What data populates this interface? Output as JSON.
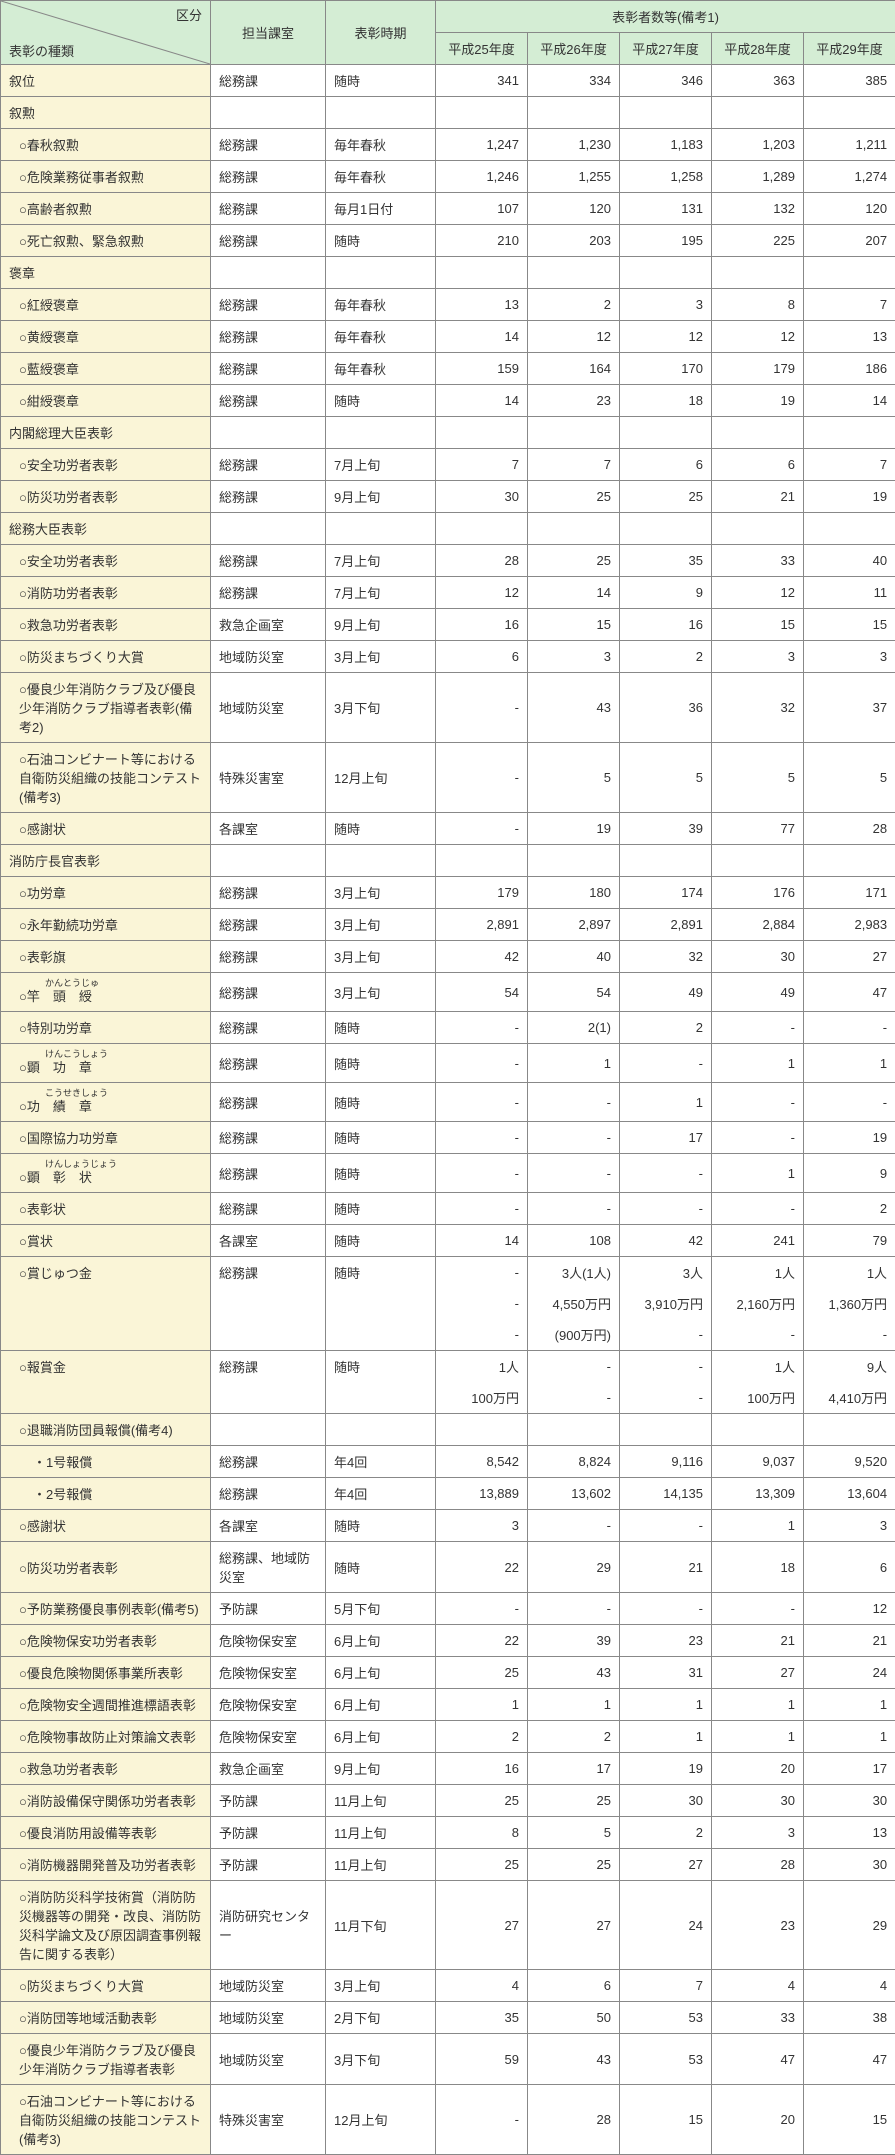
{
  "header": {
    "diag_top": "区分",
    "diag_bottom": "表彰の種類",
    "dept": "担当課室",
    "timing": "表彰時期",
    "count_group": "表彰者数等(備考1)",
    "years": [
      "平成25年度",
      "平成26年度",
      "平成27年度",
      "平成28年度",
      "平成29年度"
    ]
  },
  "rows": [
    {
      "t": "d",
      "label": "叙位",
      "dept": "総務課",
      "time": "随時",
      "v": [
        "341",
        "334",
        "346",
        "363",
        "385"
      ]
    },
    {
      "t": "c",
      "label": "叙勲"
    },
    {
      "t": "d",
      "label": "○春秋叙勲",
      "dept": "総務課",
      "time": "毎年春秋",
      "v": [
        "1,247",
        "1,230",
        "1,183",
        "1,203",
        "1,211"
      ],
      "i": 1
    },
    {
      "t": "d",
      "label": "○危険業務従事者叙勲",
      "dept": "総務課",
      "time": "毎年春秋",
      "v": [
        "1,246",
        "1,255",
        "1,258",
        "1,289",
        "1,274"
      ],
      "i": 1
    },
    {
      "t": "d",
      "label": "○高齢者叙勲",
      "dept": "総務課",
      "time": "毎月1日付",
      "v": [
        "107",
        "120",
        "131",
        "132",
        "120"
      ],
      "i": 1
    },
    {
      "t": "d",
      "label": "○死亡叙勲、緊急叙勲",
      "dept": "総務課",
      "time": "随時",
      "v": [
        "210",
        "203",
        "195",
        "225",
        "207"
      ],
      "i": 1
    },
    {
      "t": "c",
      "label": "褒章"
    },
    {
      "t": "d",
      "label": "○紅綬褒章",
      "dept": "総務課",
      "time": "毎年春秋",
      "v": [
        "13",
        "2",
        "3",
        "8",
        "7"
      ],
      "i": 1
    },
    {
      "t": "d",
      "label": "○黄綬褒章",
      "dept": "総務課",
      "time": "毎年春秋",
      "v": [
        "14",
        "12",
        "12",
        "12",
        "13"
      ],
      "i": 1
    },
    {
      "t": "d",
      "label": "○藍綬褒章",
      "dept": "総務課",
      "time": "毎年春秋",
      "v": [
        "159",
        "164",
        "170",
        "179",
        "186"
      ],
      "i": 1
    },
    {
      "t": "d",
      "label": "○紺綬褒章",
      "dept": "総務課",
      "time": "随時",
      "v": [
        "14",
        "23",
        "18",
        "19",
        "14"
      ],
      "i": 1
    },
    {
      "t": "c",
      "label": "内閣総理大臣表彰"
    },
    {
      "t": "d",
      "label": "○安全功労者表彰",
      "dept": "総務課",
      "time": "7月上旬",
      "v": [
        "7",
        "7",
        "6",
        "6",
        "7"
      ],
      "i": 1
    },
    {
      "t": "d",
      "label": "○防災功労者表彰",
      "dept": "総務課",
      "time": "9月上旬",
      "v": [
        "30",
        "25",
        "25",
        "21",
        "19"
      ],
      "i": 1
    },
    {
      "t": "c",
      "label": "総務大臣表彰"
    },
    {
      "t": "d",
      "label": "○安全功労者表彰",
      "dept": "総務課",
      "time": "7月上旬",
      "v": [
        "28",
        "25",
        "35",
        "33",
        "40"
      ],
      "i": 1
    },
    {
      "t": "d",
      "label": "○消防功労者表彰",
      "dept": "総務課",
      "time": "7月上旬",
      "v": [
        "12",
        "14",
        "9",
        "12",
        "11"
      ],
      "i": 1
    },
    {
      "t": "d",
      "label": "○救急功労者表彰",
      "dept": "救急企画室",
      "time": "9月上旬",
      "v": [
        "16",
        "15",
        "16",
        "15",
        "15"
      ],
      "i": 1
    },
    {
      "t": "d",
      "label": "○防災まちづくり大賞",
      "dept": "地域防災室",
      "time": "3月上旬",
      "v": [
        "6",
        "3",
        "2",
        "3",
        "3"
      ],
      "i": 1
    },
    {
      "t": "d",
      "label": "○優良少年消防クラブ及び優良少年消防クラブ指導者表彰(備考2)",
      "dept": "地域防災室",
      "time": "3月下旬",
      "v": [
        "-",
        "43",
        "36",
        "32",
        "37"
      ],
      "i": 1
    },
    {
      "t": "d",
      "label": "○石油コンビナート等における自衛防災組織の技能コンテスト(備考3)",
      "dept": "特殊災害室",
      "time": "12月上旬",
      "v": [
        "-",
        "5",
        "5",
        "5",
        "5"
      ],
      "i": 1
    },
    {
      "t": "d",
      "label": "○感謝状",
      "dept": "各課室",
      "time": "随時",
      "v": [
        "-",
        "19",
        "39",
        "77",
        "28"
      ],
      "i": 1
    },
    {
      "t": "c",
      "label": "消防庁長官表彰"
    },
    {
      "t": "d",
      "label": "○功労章",
      "dept": "総務課",
      "time": "3月上旬",
      "v": [
        "179",
        "180",
        "174",
        "176",
        "171"
      ],
      "i": 1
    },
    {
      "t": "d",
      "label": "○永年勤続功労章",
      "dept": "総務課",
      "time": "3月上旬",
      "v": [
        "2,891",
        "2,897",
        "2,891",
        "2,884",
        "2,983"
      ],
      "i": 1
    },
    {
      "t": "d",
      "label": "○表彰旗",
      "dept": "総務課",
      "time": "3月上旬",
      "v": [
        "42",
        "40",
        "32",
        "30",
        "27"
      ],
      "i": 1
    },
    {
      "t": "r",
      "rt": "かんとうじゅ",
      "rb": "○竿　頭　綬",
      "dept": "総務課",
      "time": "3月上旬",
      "v": [
        "54",
        "54",
        "49",
        "49",
        "47"
      ],
      "i": 1
    },
    {
      "t": "d",
      "label": "○特別功労章",
      "dept": "総務課",
      "time": "随時",
      "v": [
        "-",
        "2(1)",
        "2",
        "-",
        "-"
      ],
      "i": 1
    },
    {
      "t": "r",
      "rt": "けんこうしょう",
      "rb": "○顕　功　章",
      "dept": "総務課",
      "time": "随時",
      "v": [
        "-",
        "1",
        "-",
        "1",
        "1"
      ],
      "i": 1
    },
    {
      "t": "r",
      "rt": "こうせきしょう",
      "rb": "○功　績　章",
      "dept": "総務課",
      "time": "随時",
      "v": [
        "-",
        "-",
        "1",
        "-",
        "-"
      ],
      "i": 1
    },
    {
      "t": "d",
      "label": "○国際協力功労章",
      "dept": "総務課",
      "time": "随時",
      "v": [
        "-",
        "-",
        "17",
        "-",
        "19"
      ],
      "i": 1
    },
    {
      "t": "r",
      "rt": "けんしょうじょう",
      "rb": "○顕　彰　状",
      "dept": "総務課",
      "time": "随時",
      "v": [
        "-",
        "-",
        "-",
        "1",
        "9"
      ],
      "i": 1
    },
    {
      "t": "d",
      "label": "○表彰状",
      "dept": "総務課",
      "time": "随時",
      "v": [
        "-",
        "-",
        "-",
        "-",
        "2"
      ],
      "i": 1
    },
    {
      "t": "d",
      "label": "○賞状",
      "dept": "各課室",
      "time": "随時",
      "v": [
        "14",
        "108",
        "42",
        "241",
        "79"
      ],
      "i": 1
    },
    {
      "t": "d",
      "label": "○賞じゅつ金",
      "dept": "総務課",
      "time": "随時",
      "v": [
        "-",
        "3人(1人)",
        "3人",
        "1人",
        "1人"
      ],
      "i": 1,
      "nb": 1
    },
    {
      "t": "x",
      "v": [
        "-",
        "4,550万円",
        "3,910万円",
        "2,160万円",
        "1,360万円"
      ]
    },
    {
      "t": "x",
      "v": [
        "-",
        "(900万円)",
        "-",
        "-",
        "-"
      ],
      "nb": 0
    },
    {
      "t": "d",
      "label": "○報賞金",
      "dept": "総務課",
      "time": "随時",
      "v": [
        "1人",
        "-",
        "-",
        "1人",
        "9人"
      ],
      "i": 1,
      "nb": 1
    },
    {
      "t": "x",
      "v": [
        "100万円",
        "-",
        "-",
        "100万円",
        "4,410万円"
      ],
      "nb": 0
    },
    {
      "t": "d",
      "label": "○退職消防団員報償(備考4)",
      "dept": "",
      "time": "",
      "v": [
        "",
        "",
        "",
        "",
        ""
      ],
      "i": 1
    },
    {
      "t": "d",
      "label": "・1号報償",
      "dept": "総務課",
      "time": "年4回",
      "v": [
        "8,542",
        "8,824",
        "9,116",
        "9,037",
        "9,520"
      ],
      "i": 2
    },
    {
      "t": "d",
      "label": "・2号報償",
      "dept": "総務課",
      "time": "年4回",
      "v": [
        "13,889",
        "13,602",
        "14,135",
        "13,309",
        "13,604"
      ],
      "i": 2
    },
    {
      "t": "d",
      "label": "○感謝状",
      "dept": "各課室",
      "time": "随時",
      "v": [
        "3",
        "-",
        "-",
        "1",
        "3"
      ],
      "i": 1
    },
    {
      "t": "d",
      "label": "○防災功労者表彰",
      "dept": "総務課、地域防災室",
      "time": "随時",
      "v": [
        "22",
        "29",
        "21",
        "18",
        "6"
      ],
      "i": 1
    },
    {
      "t": "d",
      "label": "○予防業務優良事例表彰(備考5)",
      "dept": "予防課",
      "time": "5月下旬",
      "v": [
        "-",
        "-",
        "-",
        "-",
        "12"
      ],
      "i": 1
    },
    {
      "t": "d",
      "label": "○危険物保安功労者表彰",
      "dept": "危険物保安室",
      "time": "6月上旬",
      "v": [
        "22",
        "39",
        "23",
        "21",
        "21"
      ],
      "i": 1
    },
    {
      "t": "d",
      "label": "○優良危険物関係事業所表彰",
      "dept": "危険物保安室",
      "time": "6月上旬",
      "v": [
        "25",
        "43",
        "31",
        "27",
        "24"
      ],
      "i": 1
    },
    {
      "t": "d",
      "label": "○危険物安全週間推進標語表彰",
      "dept": "危険物保安室",
      "time": "6月上旬",
      "v": [
        "1",
        "1",
        "1",
        "1",
        "1"
      ],
      "i": 1
    },
    {
      "t": "d",
      "label": "○危険物事故防止対策論文表彰",
      "dept": "危険物保安室",
      "time": "6月上旬",
      "v": [
        "2",
        "2",
        "1",
        "1",
        "1"
      ],
      "i": 1
    },
    {
      "t": "d",
      "label": "○救急功労者表彰",
      "dept": "救急企画室",
      "time": "9月上旬",
      "v": [
        "16",
        "17",
        "19",
        "20",
        "17"
      ],
      "i": 1
    },
    {
      "t": "d",
      "label": "○消防設備保守関係功労者表彰",
      "dept": "予防課",
      "time": "11月上旬",
      "v": [
        "25",
        "25",
        "30",
        "30",
        "30"
      ],
      "i": 1
    },
    {
      "t": "d",
      "label": "○優良消防用設備等表彰",
      "dept": "予防課",
      "time": "11月上旬",
      "v": [
        "8",
        "5",
        "2",
        "3",
        "13"
      ],
      "i": 1
    },
    {
      "t": "d",
      "label": "○消防機器開発普及功労者表彰",
      "dept": "予防課",
      "time": "11月上旬",
      "v": [
        "25",
        "25",
        "27",
        "28",
        "30"
      ],
      "i": 1
    },
    {
      "t": "d",
      "label": "○消防防災科学技術賞（消防防災機器等の開発・改良、消防防災科学論文及び原因調査事例報告に関する表彰）",
      "dept": "消防研究センター",
      "time": "11月下旬",
      "v": [
        "27",
        "27",
        "24",
        "23",
        "29"
      ],
      "i": 1
    },
    {
      "t": "d",
      "label": "○防災まちづくり大賞",
      "dept": "地域防災室",
      "time": "3月上旬",
      "v": [
        "4",
        "6",
        "7",
        "4",
        "4"
      ],
      "i": 1
    },
    {
      "t": "d",
      "label": "○消防団等地域活動表彰",
      "dept": "地域防災室",
      "time": "2月下旬",
      "v": [
        "35",
        "50",
        "53",
        "33",
        "38"
      ],
      "i": 1
    },
    {
      "t": "d",
      "label": "○優良少年消防クラブ及び優良少年消防クラブ指導者表彰",
      "dept": "地域防災室",
      "time": "3月下旬",
      "v": [
        "59",
        "43",
        "53",
        "47",
        "47"
      ],
      "i": 1
    },
    {
      "t": "d",
      "label": "○石油コンビナート等における自衛防災組織の技能コンテスト(備考3)",
      "dept": "特殊災害室",
      "time": "12月上旬",
      "v": [
        "-",
        "28",
        "15",
        "20",
        "15"
      ],
      "i": 1
    }
  ]
}
